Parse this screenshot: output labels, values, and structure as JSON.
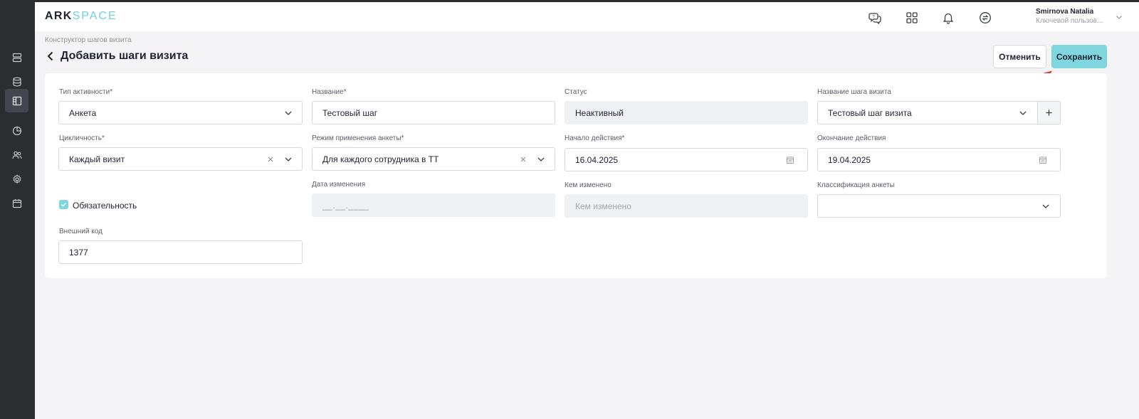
{
  "app": {
    "logo_left": "ARK",
    "logo_right": "SPACE"
  },
  "sidebar": {
    "items": [
      {
        "icon": "server-icon"
      },
      {
        "icon": "database-icon"
      },
      {
        "icon": "layout-icon",
        "active": true
      },
      {
        "icon": "pie-chart-icon"
      },
      {
        "icon": "users-icon"
      },
      {
        "icon": "gear-icon"
      },
      {
        "icon": "calendar-icon"
      }
    ]
  },
  "topbar": {
    "icons": [
      "support-chat-icon",
      "apps-grid-icon",
      "bell-icon",
      "sync-icon"
    ],
    "user": {
      "name": "Smirnova Natalia",
      "role": "Ключевой пользов..."
    }
  },
  "page": {
    "breadcrumb": "Конструктор шагов визита",
    "title": "Добавить шаги визита",
    "cancel_label": "Отменить",
    "save_label": "Сохранить"
  },
  "form": {
    "activity_type": {
      "label": "Тип активности*",
      "value": "Анкета"
    },
    "name": {
      "label": "Название*",
      "value": "Тестовый шаг"
    },
    "status": {
      "label": "Статус",
      "value": "Неактивный"
    },
    "step_name": {
      "label": "Название шага визита",
      "value": "Тестовый шаг визита"
    },
    "cyclicity": {
      "label": "Цикличность*",
      "value": "Каждый визит"
    },
    "apply_mode": {
      "label": "Режим применения анкеты*",
      "value": "Для каждого сотрудника в ТТ"
    },
    "start_date": {
      "label": "Начало действия*",
      "value": "16.04.2025"
    },
    "end_date": {
      "label": "Окончание действия",
      "value": "19.04.2025"
    },
    "mandatory": {
      "label": "Обязательность",
      "checked": true
    },
    "change_date": {
      "label": "Дата изменения",
      "mask": "__.__.____"
    },
    "changed_by": {
      "label": "Кем изменено",
      "placeholder": "Кем изменено"
    },
    "classification": {
      "label": "Классификация анкеты",
      "value": ""
    },
    "external_code": {
      "label": "Внешний код",
      "value": "1377"
    }
  },
  "colors": {
    "sidebar_bg": "#2b2d31",
    "accent": "#7fd6de",
    "annotation_arrow": "#e53935"
  }
}
